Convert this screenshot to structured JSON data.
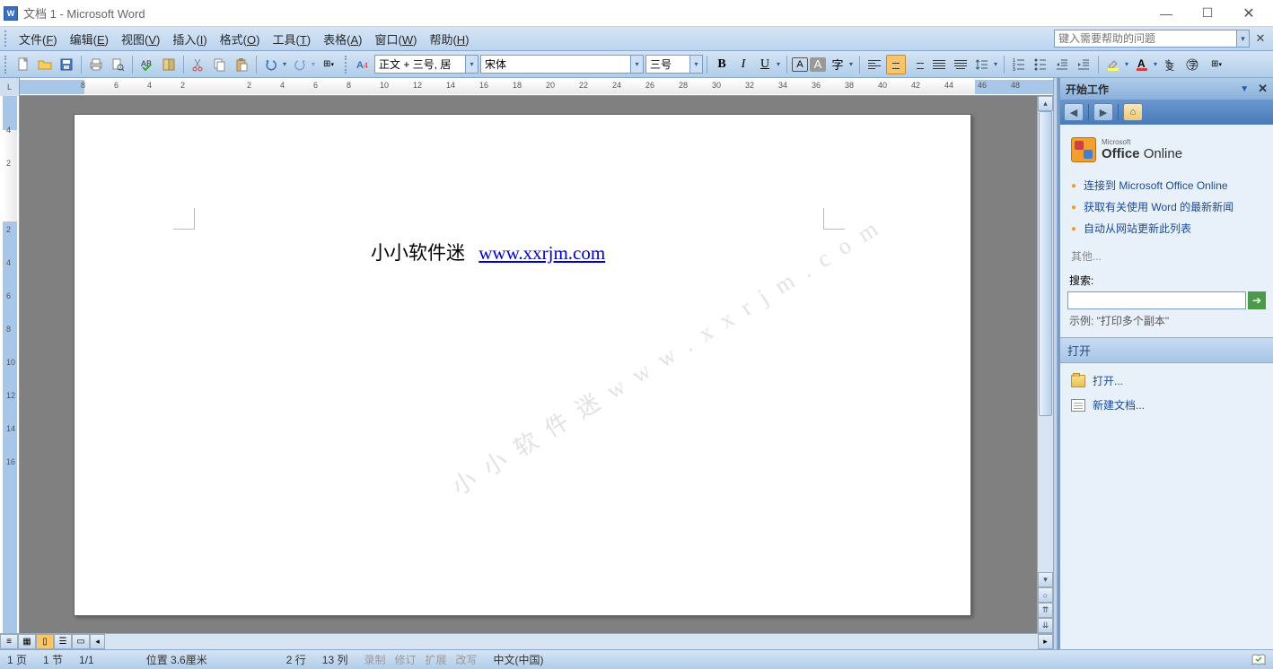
{
  "titlebar": {
    "title": "文档 1 - Microsoft Word"
  },
  "menu": {
    "file": "文件(<u>F</u>)",
    "edit": "编辑(<u>E</u>)",
    "view": "视图(<u>V</u>)",
    "insert": "插入(<u>I</u>)",
    "format": "格式(<u>O</u>)",
    "tools": "工具(<u>T</u>)",
    "table": "表格(<u>A</u>)",
    "window": "窗口(<u>W</u>)",
    "help": "帮助(<u>H</u>)",
    "help_placeholder": "键入需要帮助的问题"
  },
  "toolbar": {
    "style": "正文 + 三号, 居",
    "font": "宋体",
    "size": "三号"
  },
  "document": {
    "text": "小小软件迷",
    "link": "www.xxrjm.com",
    "watermark": "小 小 软 件 迷  w w w . x x r j m . c o m"
  },
  "taskpane": {
    "title": "开始工作",
    "office": "Office",
    "online": "Online",
    "ms": "Microsoft",
    "links": [
      "连接到 Microsoft Office Online",
      "获取有关使用 Word 的最新新闻",
      "自动从网站更新此列表"
    ],
    "other": "其他...",
    "search_label": "搜索:",
    "example": "示例:   \"打印多个副本\"",
    "open_section": "打开",
    "open_link": "打开...",
    "new_doc": "新建文档..."
  },
  "status": {
    "page": "1 页",
    "sec": "1 节",
    "pages": "1/1",
    "pos": "位置 3.6厘米",
    "line": "2 行",
    "col": "13 列",
    "rec": "录制",
    "rev": "修订",
    "ext": "扩展",
    "ovr": "改写",
    "lang": "中文(中国)"
  },
  "ruler": {
    "h": [
      "8",
      "6",
      "4",
      "2",
      "",
      "2",
      "4",
      "6",
      "8",
      "10",
      "12",
      "14",
      "16",
      "18",
      "20",
      "22",
      "24",
      "26",
      "28",
      "30",
      "32",
      "34",
      "36",
      "38",
      "40",
      "42",
      "44",
      "46",
      "48"
    ],
    "v": [
      "4",
      "2",
      "",
      "2",
      "4",
      "6",
      "8",
      "10",
      "12",
      "14",
      "16"
    ]
  }
}
